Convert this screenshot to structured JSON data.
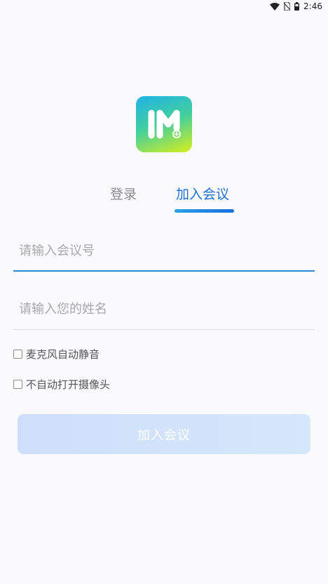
{
  "status_bar": {
    "time": "2:46",
    "icons": [
      "wifi-icon",
      "no-sim-icon",
      "battery-icon"
    ]
  },
  "logo": {
    "icon": "app-logo-icon"
  },
  "tabs": [
    {
      "label": "登录",
      "active": false
    },
    {
      "label": "加入会议",
      "active": true
    }
  ],
  "form": {
    "meeting_id_placeholder": "请输入会议号",
    "meeting_id_value": "",
    "name_placeholder": "请输入您的姓名",
    "name_value": ""
  },
  "options": [
    {
      "label": "麦克风自动静音",
      "checked": false
    },
    {
      "label": "不自动打开摄像头",
      "checked": false
    }
  ],
  "join_button": {
    "label": "加入会议",
    "enabled": false
  },
  "colors": {
    "accent": "#1f6fd6",
    "active_line": "#2b8ad6",
    "button_disabled": "#d0e2fb"
  }
}
